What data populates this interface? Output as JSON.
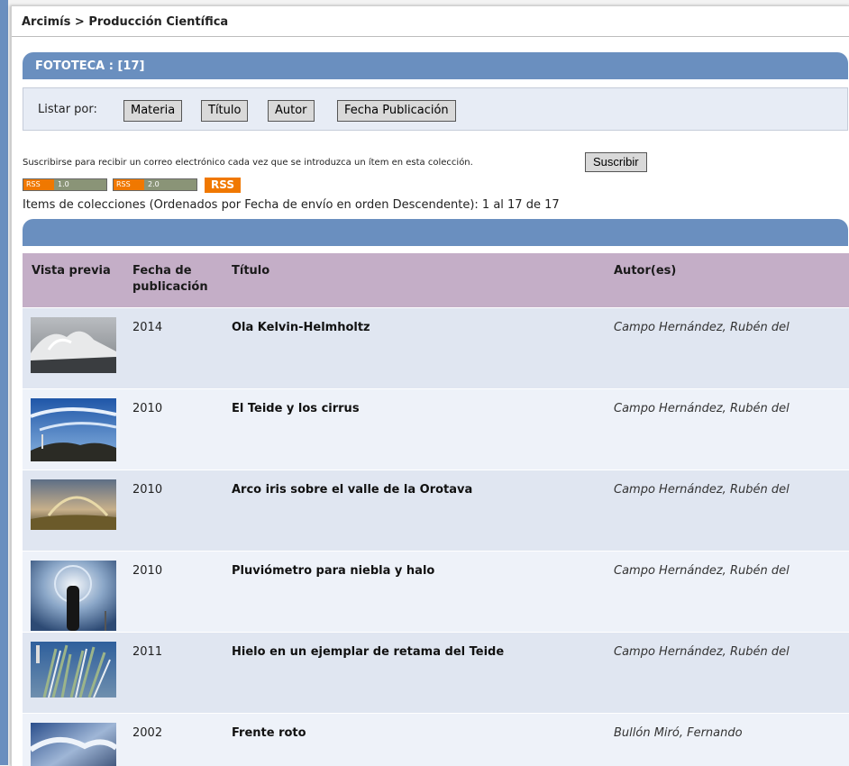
{
  "breadcrumb": "Arcimís > Producción Científica",
  "collection": {
    "title": "FOTOTECA : [17]"
  },
  "listar": {
    "label": "Listar por:",
    "buttons": [
      "Materia",
      "Título",
      "Autor",
      "Fecha Publicación"
    ]
  },
  "subscribe": {
    "text": "Suscribirse para recibir un correo electrónico cada vez que se introduzca un ítem en esta colección.",
    "button": "Suscribir"
  },
  "rss": {
    "badge1_left": "RSS",
    "badge1_right": "1.0",
    "badge2_left": "RSS",
    "badge2_right": "2.0",
    "main": "RSS"
  },
  "items_info": "Items de colecciones (Ordenados por Fecha de envío en orden Descendente): 1 al 17 de 17",
  "table": {
    "headers": {
      "preview": "Vista previa",
      "date_line1": "Fecha de",
      "date_line2": "publicación",
      "title": "Título",
      "author": "Autor(es)"
    },
    "rows": [
      {
        "year": "2014",
        "title": "Ola Kelvin-Helmholtz",
        "author": "Campo Hernández, Rubén del",
        "thumb": "wave-photo"
      },
      {
        "year": "2010",
        "title": "El Teide y los cirrus",
        "author": "Campo Hernández, Rubén del",
        "thumb": "teide-cirrus-photo"
      },
      {
        "year": "2010",
        "title": "Arco iris sobre el valle de la Orotava",
        "author": "Campo Hernández, Rubén del",
        "thumb": "rainbow-photo"
      },
      {
        "year": "2010",
        "title": "Pluviómetro para niebla y halo",
        "author": "Campo Hernández, Rubén del",
        "thumb": "halo-photo"
      },
      {
        "year": "2011",
        "title": "Hielo en un ejemplar de retama del Teide",
        "author": "Campo Hernández, Rubén del",
        "thumb": "ice-retama-photo"
      },
      {
        "year": "2002",
        "title": "Frente roto",
        "author": "Bullón Miró, Fernando",
        "thumb": "storm-front-photo"
      }
    ]
  },
  "colors": {
    "accent_blue": "#6a8fbf",
    "header_purple": "#c4aec7",
    "row_odd": "#e0e6f1",
    "row_even": "#eef2f9",
    "rss_orange": "#f07800"
  }
}
